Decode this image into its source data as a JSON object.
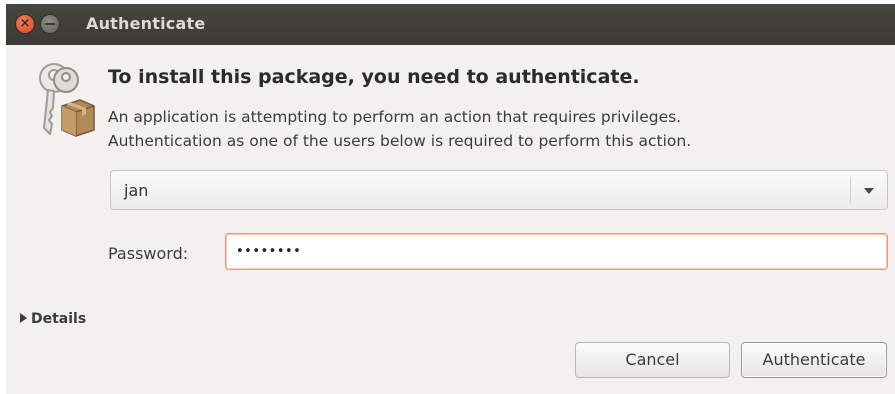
{
  "window": {
    "title": "Authenticate"
  },
  "dialog": {
    "icon": "keys-package-icon",
    "heading": "To install this package, you need to authenticate.",
    "description_line1": "An application is attempting to perform an action that requires privileges.",
    "description_line2": "Authentication as one of the users below is required to perform this action."
  },
  "user_select": {
    "selected": "jan",
    "options": [
      "jan"
    ]
  },
  "password": {
    "label": "Password:",
    "masked_value": "••••••••"
  },
  "details": {
    "label": "Details",
    "expanded": false
  },
  "buttons": {
    "cancel": "Cancel",
    "authenticate": "Authenticate"
  },
  "colors": {
    "titlebar": "#3c3b37",
    "close_button": "#e0552c",
    "dialog_bg": "#f2f1f0",
    "focus_border": "#e9987a"
  }
}
